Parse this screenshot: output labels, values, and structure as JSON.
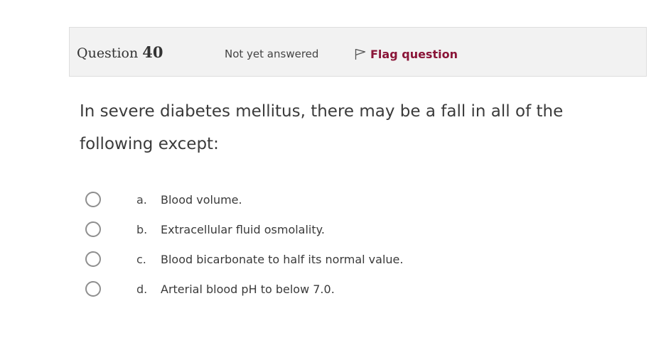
{
  "question": {
    "label": "Question",
    "number": "40",
    "status": "Not yet answered",
    "flag_label": "Flag question",
    "flag_icon": "flag-outline-icon",
    "text": "In severe diabetes mellitus, there may be a fall in all of the following except:"
  },
  "answers": [
    {
      "letter": "a.",
      "text": "Blood volume.",
      "selected": false
    },
    {
      "letter": "b.",
      "text": "Extracellular fluid osmolality.",
      "selected": false
    },
    {
      "letter": "c.",
      "text": "Blood bicarbonate to half its normal value.",
      "selected": false
    },
    {
      "letter": "d.",
      "text": "Arterial blood pH to below 7.0.",
      "selected": false
    }
  ],
  "colors": {
    "header_bg": "#f2f2f2",
    "flag_text": "#8a1538",
    "radio_border": "#8e8e8e"
  }
}
